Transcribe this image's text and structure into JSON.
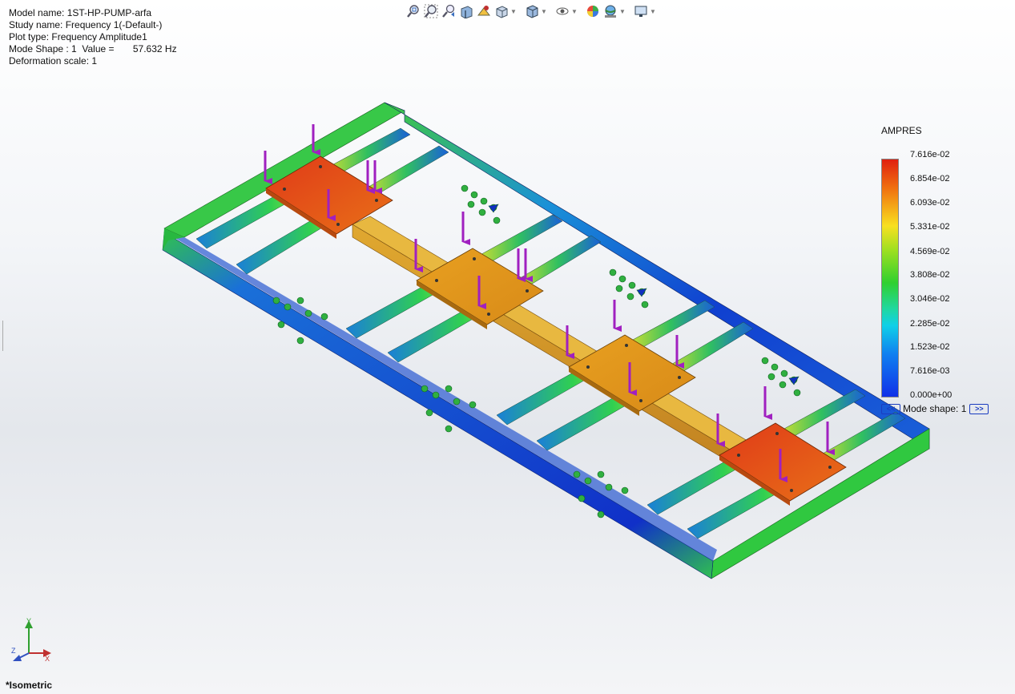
{
  "info": {
    "model_name": "Model name: 1ST-HP-PUMP-arfa",
    "study_name": "Study name: Frequency 1(-Default-)",
    "plot_type": "Plot type: Frequency Amplitude1",
    "mode_shape": "Mode Shape : 1  Value =       57.632 Hz",
    "deformation": "Deformation scale: 1"
  },
  "toolbar": {
    "icons": [
      "zoom-to-fit-icon",
      "zoom-to-area-icon",
      "previous-view-icon",
      "section-view-icon",
      "dynamic-annotation-icon",
      "view-orientation-icon",
      "display-style-icon",
      "hide-show-items-icon",
      "edit-appearance-icon",
      "apply-scene-icon",
      "view-settings-icon"
    ]
  },
  "legend": {
    "title": "AMPRES",
    "labels": [
      "7.616e-02",
      "6.854e-02",
      "6.093e-02",
      "5.331e-02",
      "4.569e-02",
      "3.808e-02",
      "3.046e-02",
      "2.285e-02",
      "1.523e-02",
      "7.616e-03",
      "0.000e+00"
    ],
    "colors": {
      "max": "#e02010",
      "mid": "#30d030",
      "min": "#1030e8"
    }
  },
  "mode_shape_control": {
    "label": "Mode shape: 1",
    "prev": "<<",
    "next": ">>"
  },
  "triad": {
    "x": "X",
    "y": "Y",
    "z": "Z"
  },
  "view_name": "*Isometric"
}
